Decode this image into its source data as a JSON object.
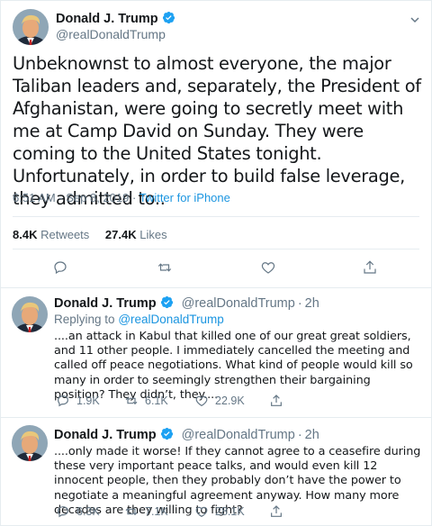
{
  "main_tweet": {
    "author_name": "Donald J. Trump",
    "author_handle": "@realDonaldTrump",
    "text": "Unbeknownst to almost everyone, the major Taliban leaders and, separately, the President of Afghanistan, were going to secretly meet with me at Camp David on Sunday. They were coming to the United States tonight. Unfortunately, in order to build false leverage, they admitted to..",
    "timestamp": "6:51 AM - Sep 8, 2019",
    "separator": " · ",
    "source": "Twitter for iPhone",
    "retweets_count": "8.4K",
    "retweets_label": "Retweets",
    "likes_count": "27.4K",
    "likes_label": "Likes"
  },
  "replies": [
    {
      "author_name": "Donald J. Trump",
      "author_handle": "@realDonaldTrump",
      "time": "2h",
      "replying_label": "Replying to",
      "replying_to": "@realDonaldTrump",
      "text": "....an attack in Kabul that killed one of our great great soldiers, and 11 other people. I immediately cancelled the meeting and called off peace negotiations. What kind of people would kill so many in order to seemingly strengthen their bargaining position? They didn’t, they....",
      "replies_count": "1.9K",
      "retweets_count": "6.1K",
      "likes_count": "22.9K"
    },
    {
      "author_name": "Donald J. Trump",
      "author_handle": "@realDonaldTrump",
      "time": "2h",
      "text": "....only made it worse! If they cannot agree to a ceasefire during these very important peace talks, and would even kill 12 innocent people, then they probably don’t have the power to negotiate a meaningful agreement anyway. How many more decades are they willing to fight?",
      "replies_count": "6.3K",
      "retweets_count": "7.1K",
      "likes_count": "28.1K"
    }
  ],
  "colors": {
    "accent": "#1b95e0",
    "text": "#14171a",
    "muted": "#657786",
    "border": "#e6ecf0"
  },
  "icons": [
    "verified-badge-icon",
    "chevron-down-icon",
    "reply-icon",
    "retweet-icon",
    "like-icon",
    "share-icon"
  ]
}
